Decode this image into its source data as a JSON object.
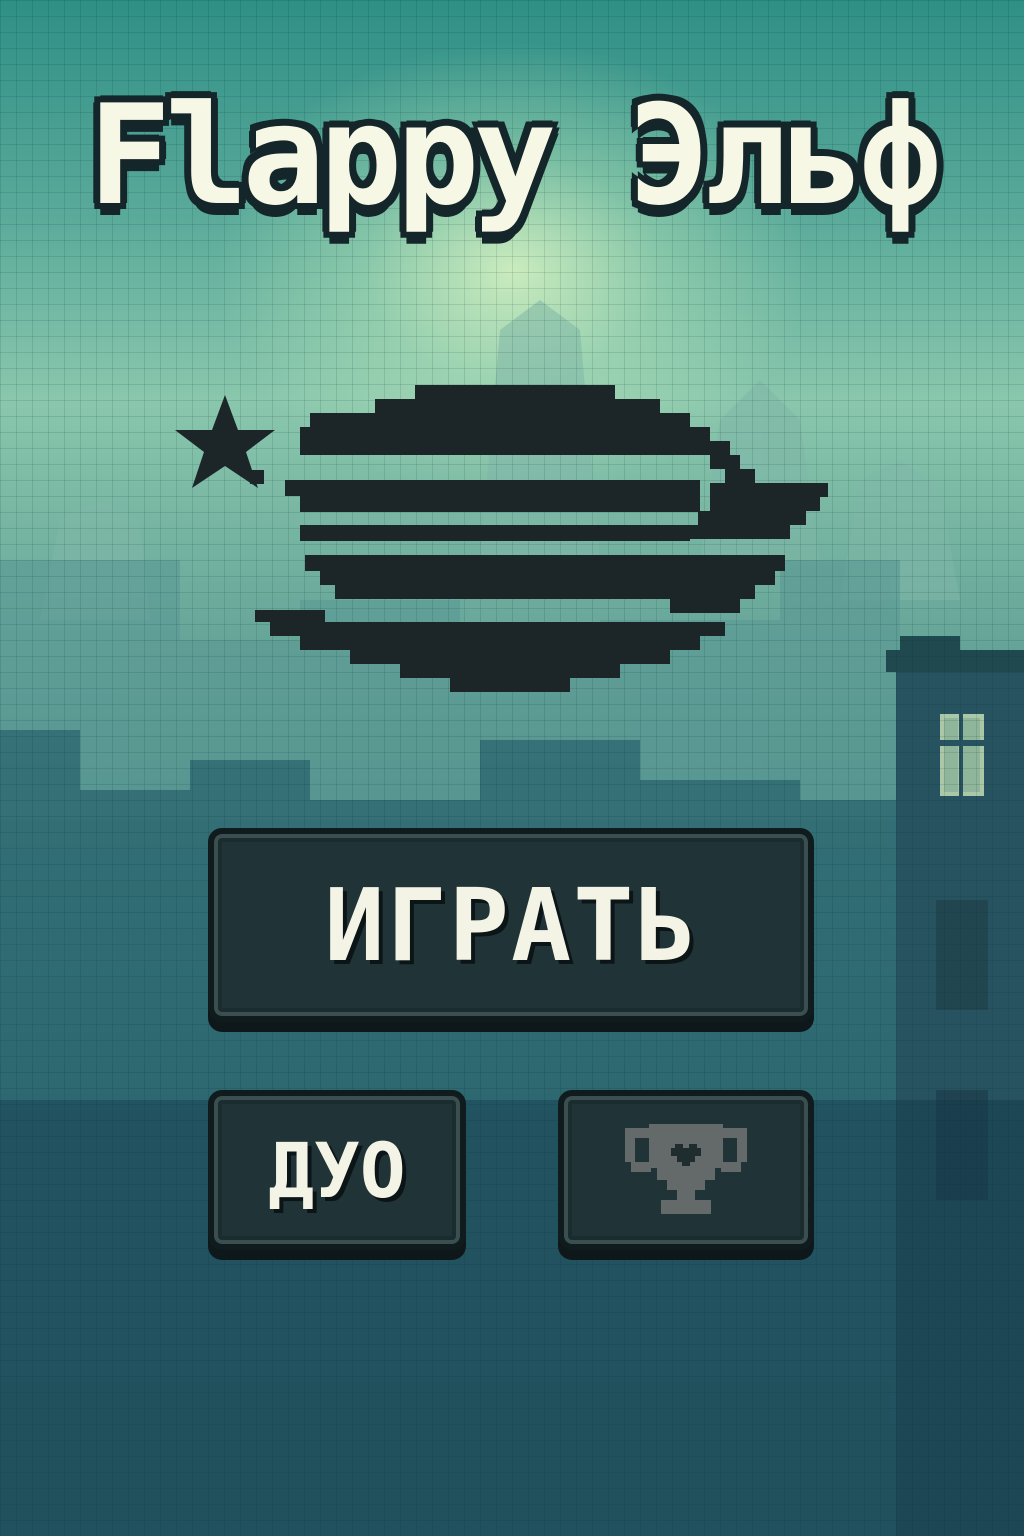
{
  "game": {
    "title": "Flappy Эльф"
  },
  "menu": {
    "play_label": "ИГРАТЬ",
    "duo_label": "ДУО",
    "leaderboard_icon": "trophy-icon"
  },
  "theme": {
    "sky_top": "#2f8f86",
    "sky_glow": "#e8f8c0",
    "sky_bottom": "#1a4356",
    "logo_text": "#f7f7e6",
    "logo_outline": "#15262a",
    "button_fill": "#203437",
    "button_border": "#0f1b1d",
    "emblem_color": "#1c2628",
    "trophy_color": "#646a6a"
  }
}
